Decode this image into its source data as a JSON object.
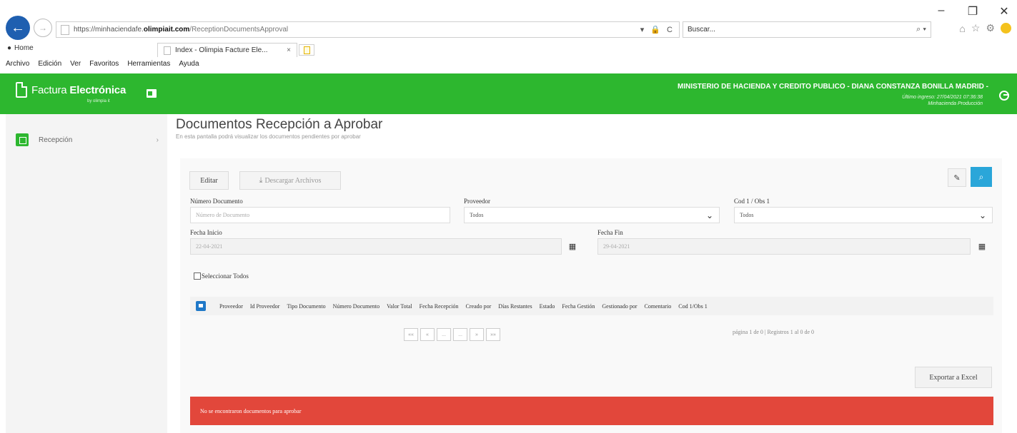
{
  "browser": {
    "url_prefix": "https://minhaciendafe.",
    "url_host": "olimpiait.com",
    "url_path": "/ReceptionDocumentsApproval",
    "address_tools": "▾ 🔒 C",
    "search_placeholder": "Buscar...",
    "search_tools": "⌕ ▾",
    "favorite": "Home",
    "tab_title": "Index - Olimpia Facture Ele...",
    "tab_close": "×",
    "menu": [
      "Archivo",
      "Edición",
      "Ver",
      "Favoritos",
      "Herramientas",
      "Ayuda"
    ],
    "window_controls": [
      "–",
      "❐",
      "✕"
    ]
  },
  "header": {
    "brand_light": "Factura ",
    "brand_bold": "Electrónica",
    "brand_sub": "by olimpia it",
    "user": "MINISTERIO DE HACIENDA Y CREDITO PUBLICO - DIANA CONSTANZA BONILLA MADRID -",
    "last_login": "Último ingreso: 27/04/2021 07:36:38",
    "environment": "Minhacienda Producción"
  },
  "sidebar": {
    "items": [
      {
        "label": "Recepción",
        "chevron": "›"
      }
    ]
  },
  "page": {
    "title": "Documentos Recepción a Aprobar",
    "subtitle": "En esta pantalla podrá visualizar los documentos pendientes por aprobar"
  },
  "toolbar": {
    "edit": "Editar",
    "download": "Descargar Archivos",
    "download_icon": "⤓",
    "clear_icon": "✎",
    "search_icon": "⌕"
  },
  "filters": {
    "numero_label": "Número Documento",
    "numero_placeholder": "Número de Documento",
    "proveedor_label": "Proveedor",
    "proveedor_value": "Todos",
    "cod_label": "Cod 1 / Obs 1",
    "cod_value": "Todos",
    "fecha_inicio_label": "Fecha Inicio",
    "fecha_inicio_value": "22-04-2021",
    "fecha_fin_label": "Fecha Fin",
    "fecha_fin_value": "29-04-2021",
    "caret": "⌄",
    "calendar_icon": "▦"
  },
  "select_all": "Seleccionar Todos",
  "table": {
    "columns": [
      "Proveedor",
      "Id Proveedor",
      "Tipo Documento",
      "Número Documento",
      "Valor Total",
      "Fecha Recepción",
      "Creado por",
      "Días Restantes",
      "Estado",
      "Fecha Gestión",
      "Gestionado por",
      "Comentario",
      "Cod 1/Obs 1"
    ]
  },
  "pagination": {
    "buttons": [
      "««",
      "«",
      "...",
      "...",
      "»",
      "»»"
    ],
    "info": "página 1 de 0 | Registros 1 al 0 de 0"
  },
  "export": "Exportar a Excel",
  "alert": "No se encontraron documentos para aprobar"
}
